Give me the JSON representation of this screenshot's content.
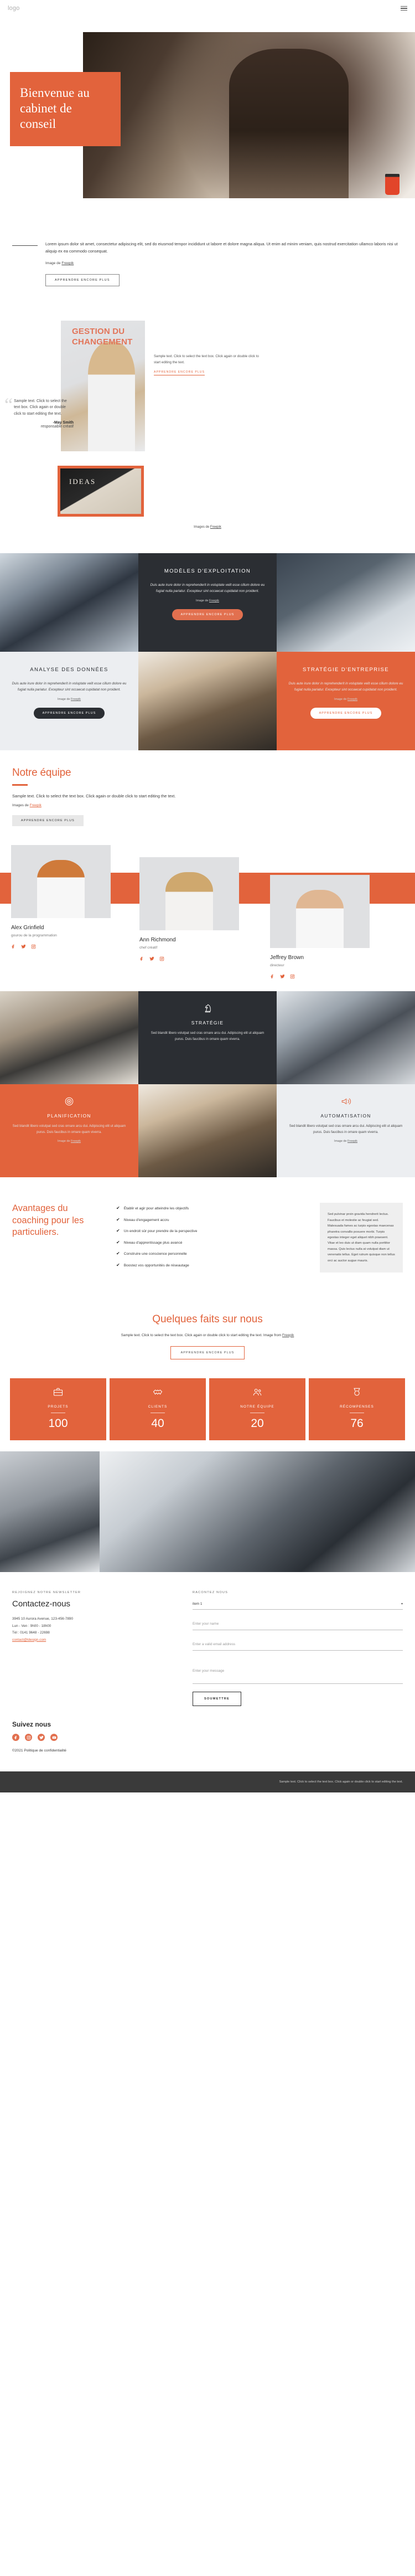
{
  "header": {
    "logo": "logo",
    "menu_icon": "hamburger-icon"
  },
  "hero": {
    "title": "Bienvenue au cabinet de conseil",
    "body": "Lorem ipsum dolor sit amet, consectetur adipiscing elit, sed do eiusmod tempor incididunt ut labore et dolore magna aliqua. Ut enim ad minim veniam, quis nostrud exercitation ullamco laboris nisi ut aliquip ex ea commodo consequat.",
    "credit_prefix": "Image de ",
    "credit_link": "Freepik",
    "button": "APPRENDRE ENCORE PLUS"
  },
  "change": {
    "title": "GESTION DU CHANGEMENT",
    "quote": "Sample text. Click to select the text box. Click again or double click to start editing the text.",
    "author": "-May Smith",
    "role": "responsable créatif",
    "right_text": "Sample text. Click to select the text box. Click again or double click to start editing the text.",
    "right_link": "APPRENDRE ENCORE PLUS",
    "card_label": "IDEAS",
    "credit_prefix": "Images de ",
    "credit_link": "Freepik"
  },
  "services": [
    {
      "kind": "photo",
      "photo": "ph-a"
    },
    {
      "kind": "dark",
      "title": "MODÈLES D'EXPLOITATION",
      "body": "Duis aute irure dolor in reprehenderit in voluptate velit esse cillum dolore eu fugiat nulla pariatur. Excepteur sint occaecat cupidatat non proident.",
      "credit_prefix": "Image de ",
      "credit_link": "Freepik",
      "button": "APPRENDRE ENCORE PLUS",
      "button_style": "orange"
    },
    {
      "kind": "photo",
      "photo": "ph-c"
    },
    {
      "kind": "light",
      "title": "ANALYSE DES DONNÉES",
      "body": "Duis aute irure dolor in reprehenderit in voluptate velit esse cillum dolore eu fugiat nulla pariatur. Excepteur sint occaecat cupidatat non proident.",
      "credit_prefix": "Image de ",
      "credit_link": "Freepik",
      "button": "APPRENDRE ENCORE PLUS",
      "button_style": "dark"
    },
    {
      "kind": "photo",
      "photo": "ph-d"
    },
    {
      "kind": "orange",
      "title": "STRATÉGIE D'ENTREPRISE",
      "body": "Duis aute irure dolor in reprehenderit in voluptate velit esse cillum dolore eu fugiat nulla pariatur. Excepteur sint occaecat cupidatat non proident.",
      "credit_prefix": "Image de ",
      "credit_link": "Freepik",
      "button": "APPRENDRE ENCORE PLUS",
      "button_style": "white"
    }
  ],
  "team": {
    "title": "Notre équipe",
    "subtitle": "Sample text. Click to select the text box. Click again or double click to start editing the text.",
    "credit_prefix": "Images de ",
    "credit_link": "Freepik",
    "button": "APPRENDRE ENCORE PLUS",
    "members": [
      {
        "name": "Alex Grinfield",
        "role": "gourou de la programmation"
      },
      {
        "name": "Ann Richmond",
        "role": "chef créatif"
      },
      {
        "name": "Jeffrey Brown",
        "role": "directeur"
      }
    ],
    "social_icons": [
      "facebook-icon",
      "twitter-icon",
      "instagram-icon"
    ]
  },
  "features": [
    {
      "kind": "photo",
      "photo": "ph-b"
    },
    {
      "kind": "dark",
      "icon": "chess-knight-icon",
      "title": "STRATÉGIE",
      "body": "Sed blandit libero volutpat sed cras ornare arcu dui. Adipiscing elit ut aliquam purus. Duis faucibus in ornare quam viverra."
    },
    {
      "kind": "photo",
      "photo": "ph-e"
    },
    {
      "kind": "orange",
      "icon": "target-icon",
      "title": "PLANIFICATION",
      "body": "Sed blandit libero volutpat sed cras ornare arcu dui. Adipiscing elit ut aliquam purus. Duis faucibus in ornare quam viverra.",
      "credit_prefix": "Image de ",
      "credit_link": "Freepik"
    },
    {
      "kind": "photo",
      "photo": "ph-d"
    },
    {
      "kind": "light",
      "icon": "megaphone-icon",
      "title": "AUTOMATISATION",
      "body": "Sed blandit libero volutpat sed cras ornare arcu dui. Adipiscing elit ut aliquam purus. Duis faucibus in ornare quam viverra.",
      "credit_prefix": "Image de ",
      "credit_link": "Freepik"
    }
  ],
  "advantages": {
    "title": "Avantages du coaching pour les particuliers.",
    "items": [
      "Établir et agir pour atteindre les objectifs",
      "Niveau d'engagement accru",
      "Un endroit sûr pour prendre de la perspective",
      "Niveau d'apprentissage plus avancé",
      "Construire une conscience personnelle",
      "Boostez vos opportunités de réseautage"
    ],
    "side_text": "Sed pulvinar proin gravida hendrerit lectus. Faucibus et molestie ac feugiat sed. Malesuada fames ac turpis egestas maecenas pharetra convallis posuere morbi. Turpis egestas integer eget aliquet nibh praesent. Vitae et leo duis ut diam quam nulla porttitor massa. Quis lectus nulla at volutpat diam ut venenatis tellus. Eget rutrum quisque non tellus orci ac auctor augue mauris."
  },
  "facts": {
    "title": "Quelques faits sur nous",
    "subtitle": "Sample text. Click to select the text box. Click again or double click to start editing the text. Image from ",
    "credit_link": "Freepik",
    "button": "APPRENDRE ENCORE PLUS",
    "stats": [
      {
        "icon": "briefcase-icon",
        "label": "PROJETS",
        "value": "100"
      },
      {
        "icon": "handshake-icon",
        "label": "CLIENTS",
        "value": "40"
      },
      {
        "icon": "users-icon",
        "label": "NOTRE ÉQUIPE",
        "value": "20"
      },
      {
        "icon": "medal-icon",
        "label": "RÉCOMPENSES",
        "value": "76"
      }
    ]
  },
  "contact": {
    "kicker": "REJOIGNEZ NOTRE NEWSLETTER",
    "title": "Contactez-nous",
    "lines": [
      "3945 10 Aurora Avenue, 123-456-7890",
      "Lun - Ven : 9h00 - 18h00",
      "Tél : 0141 9648 - 22698",
      "contact@ldesign.com"
    ],
    "email_link": "contact@ldesign.com",
    "form_label": "RACONTEZ NOUS",
    "select_value": "item 1",
    "select_caret": "chevron-down-icon",
    "name_placeholder": "Enter your name",
    "email_placeholder": "Enter a valid email address",
    "message_placeholder": "Enter your message",
    "submit": "SOUMETTRE"
  },
  "follow": {
    "title": "Suivez nous",
    "icons": [
      "facebook-icon",
      "instagram-icon",
      "twitter-icon",
      "youtube-icon"
    ],
    "copyright": "©2021 Politique de confidentialité"
  },
  "bottom": {
    "text": "Sample text. Click to select the text box. Click again or double click to start editing the text."
  },
  "colors": {
    "accent": "#e2633c",
    "accent_light": "#e2755a",
    "dark": "#2b2e33",
    "light": "#eceef1"
  }
}
